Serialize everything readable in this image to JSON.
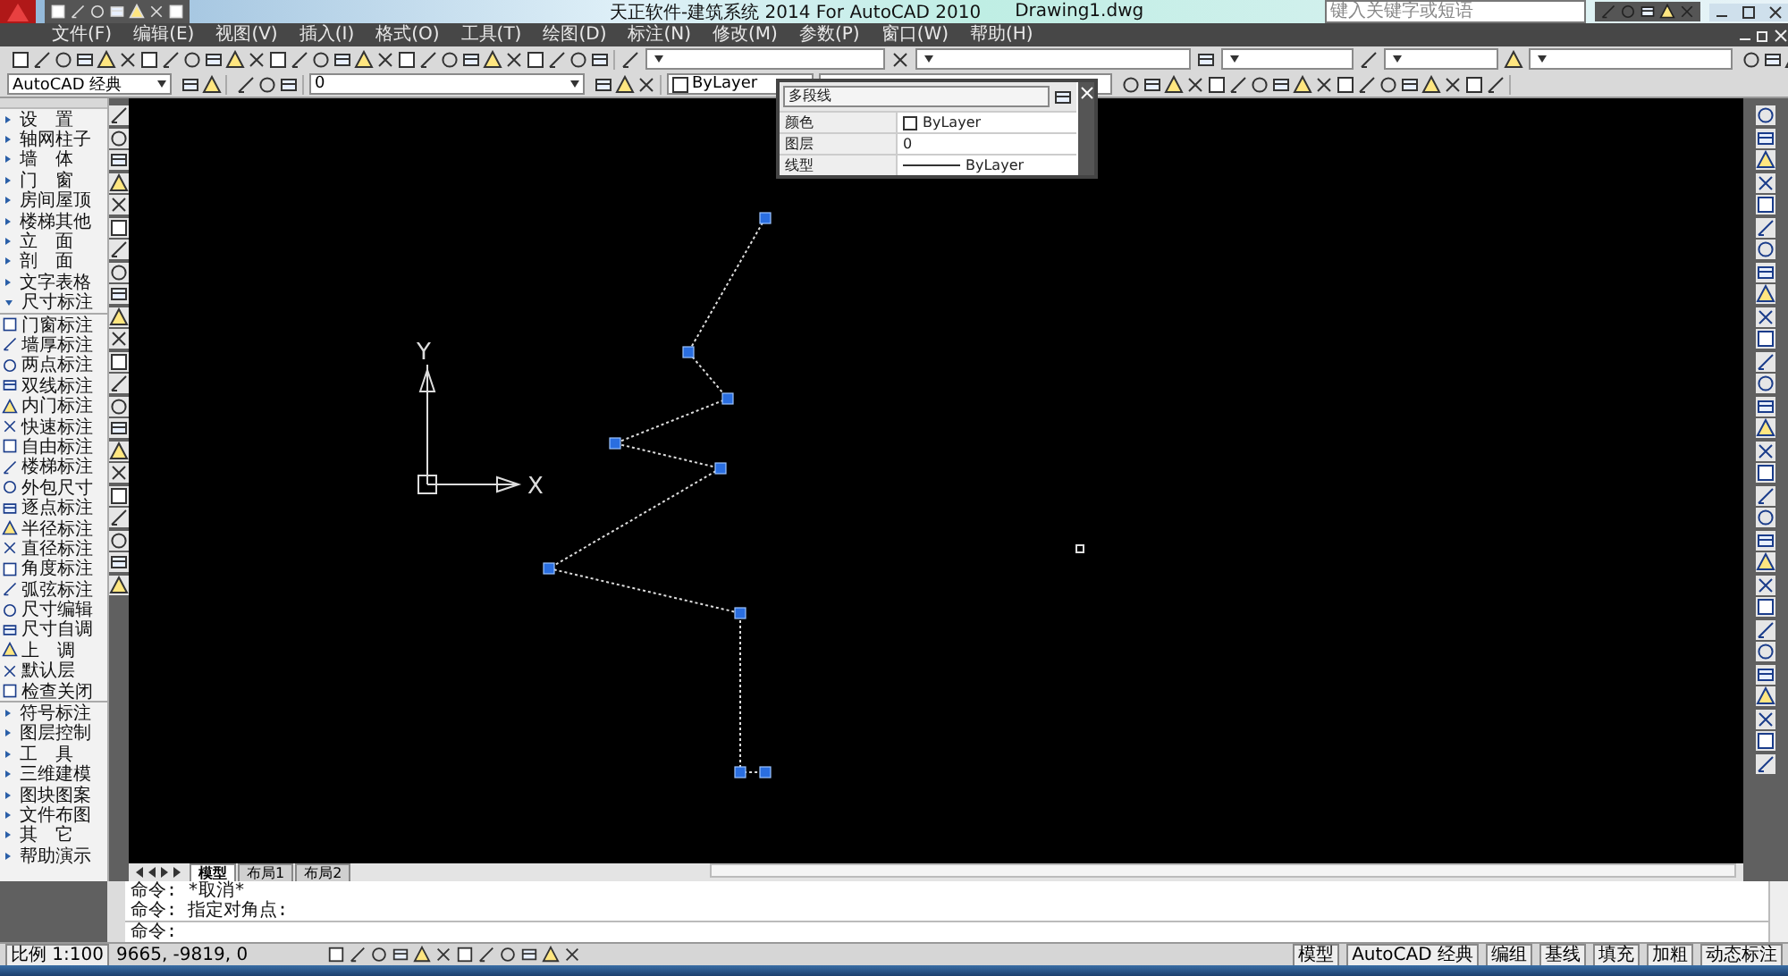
{
  "window": {
    "title": "天正软件-建筑系统 2014  For AutoCAD 2010",
    "document": "Drawing1.dwg"
  },
  "search": {
    "placeholder": "键入关键字或短语"
  },
  "menu": [
    {
      "label": "文件(F)"
    },
    {
      "label": "编辑(E)"
    },
    {
      "label": "视图(V)"
    },
    {
      "label": "插入(I)"
    },
    {
      "label": "格式(O)"
    },
    {
      "label": "工具(T)"
    },
    {
      "label": "绘图(D)"
    },
    {
      "label": "标注(N)"
    },
    {
      "label": "修改(M)"
    },
    {
      "label": "参数(P)"
    },
    {
      "label": "窗口(W)"
    },
    {
      "label": "帮助(H)"
    }
  ],
  "toolbar": {
    "workspace": "AutoCAD 经典",
    "layer": "0",
    "object_color": "ByLayer"
  },
  "properties_popup": {
    "object_type": "多段线",
    "rows": [
      {
        "label": "颜色",
        "value": "ByLayer",
        "kind": "color"
      },
      {
        "label": "图层",
        "value": "0",
        "kind": "text"
      },
      {
        "label": "线型",
        "value": "ByLayer",
        "kind": "linetype"
      }
    ]
  },
  "sidebar": {
    "items": [
      {
        "label": "设　置",
        "expanded": false
      },
      {
        "label": "轴网柱子",
        "expanded": false
      },
      {
        "label": "墙　体",
        "expanded": false
      },
      {
        "label": "门　窗",
        "expanded": false
      },
      {
        "label": "房间屋顶",
        "expanded": false
      },
      {
        "label": "楼梯其他",
        "expanded": false
      },
      {
        "label": "立　面",
        "expanded": false
      },
      {
        "label": "剖　面",
        "expanded": false
      },
      {
        "label": "文字表格",
        "expanded": false
      },
      {
        "label": "尺寸标注",
        "expanded": true,
        "children": [
          {
            "label": "门窗标注"
          },
          {
            "label": "墙厚标注"
          },
          {
            "label": "两点标注"
          },
          {
            "label": "双线标注"
          },
          {
            "label": "内门标注"
          },
          {
            "label": "快速标注"
          },
          {
            "label": "自由标注"
          },
          {
            "label": "楼梯标注"
          },
          {
            "label": "外包尺寸"
          },
          {
            "label": "逐点标注"
          },
          {
            "label": "半径标注"
          },
          {
            "label": "直径标注"
          },
          {
            "label": "角度标注"
          },
          {
            "label": "弧弦标注"
          },
          {
            "label": "尺寸编辑"
          },
          {
            "label": "尺寸自调"
          },
          {
            "label": "上　调"
          },
          {
            "label": "默认层"
          },
          {
            "label": "检查关闭"
          }
        ]
      },
      {
        "label": "符号标注",
        "expanded": false
      },
      {
        "label": "图层控制",
        "expanded": false
      },
      {
        "label": "工　具",
        "expanded": false
      },
      {
        "label": "三维建模",
        "expanded": false
      },
      {
        "label": "图块图案",
        "expanded": false
      },
      {
        "label": "文件布图",
        "expanded": false
      },
      {
        "label": "其　它",
        "expanded": false
      },
      {
        "label": "帮助演示",
        "expanded": false
      }
    ]
  },
  "ucs": {
    "x_label": "X",
    "y_label": "Y"
  },
  "layout_tabs": [
    {
      "label": "模型",
      "selected": true
    },
    {
      "label": "布局1",
      "selected": false
    },
    {
      "label": "布局2",
      "selected": false
    }
  ],
  "command_line": {
    "history": [
      "命令: *取消*",
      "命令: 指定对角点:"
    ],
    "prompt": "命令:"
  },
  "status_bar": {
    "scale": "比例 1:100",
    "coordinates": "9665, -9819, 0",
    "right_items": [
      {
        "label": "模型"
      },
      {
        "label": "AutoCAD 经典"
      },
      {
        "label": "编组"
      },
      {
        "label": "基线"
      },
      {
        "label": "填充"
      },
      {
        "label": "加粗"
      },
      {
        "label": "动态标注"
      }
    ]
  }
}
